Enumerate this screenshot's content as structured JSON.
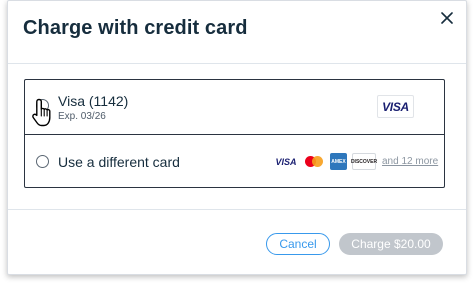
{
  "dialog": {
    "title": "Charge with credit card"
  },
  "cards": {
    "saved": {
      "name": "Visa (1142)",
      "expiry": "Exp. 03/26",
      "brand": "VISA",
      "selected": false
    },
    "other": {
      "label": "Use a different card",
      "selected": false,
      "logos": {
        "visa": "VISA",
        "amex": "AMEX",
        "discover": "DISCOVER"
      },
      "more_link": "and 12 more"
    }
  },
  "footer": {
    "cancel_label": "Cancel",
    "charge_label": "Charge $20.00",
    "charge_enabled": false
  },
  "colors": {
    "accent": "#3899ec",
    "disabled_button": "#c1c6cc",
    "text": "#162d3d"
  },
  "icons": [
    "close-icon",
    "pointer-hand-cursor-icon"
  ]
}
